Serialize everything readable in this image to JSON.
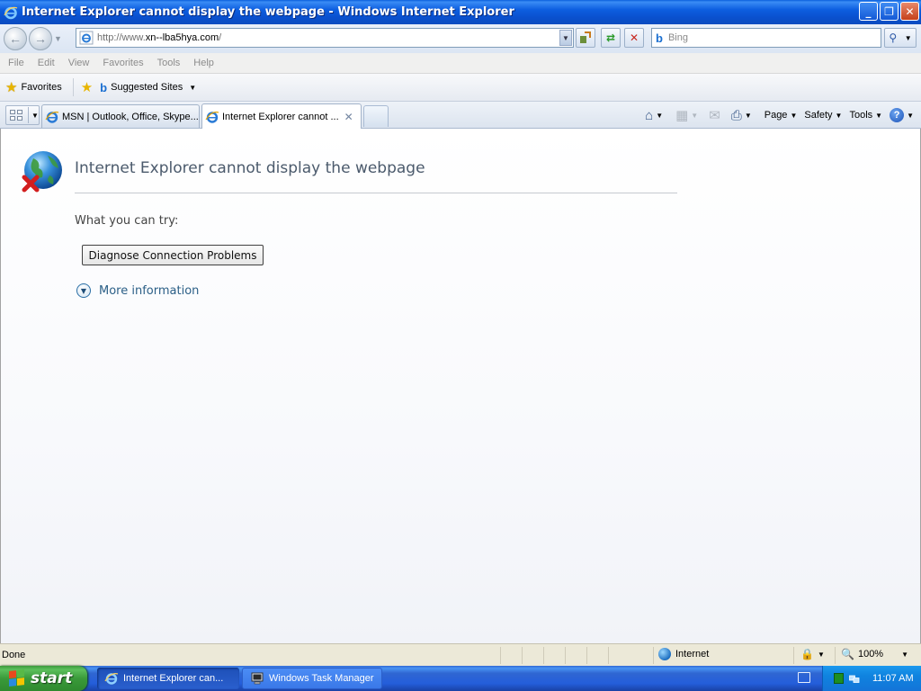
{
  "window": {
    "title": "Internet Explorer cannot display the webpage - Windows Internet Explorer",
    "minimize_glyph": "_",
    "restore_glyph": "❐",
    "close_glyph": "✕"
  },
  "address_bar": {
    "url_prefix": "http://www.",
    "url_host": "xn--lba5hya.com",
    "url_suffix": "/",
    "search_placeholder": "Bing"
  },
  "menu": {
    "items": [
      "File",
      "Edit",
      "View",
      "Favorites",
      "Tools",
      "Help"
    ]
  },
  "favorites_bar": {
    "favorites_label": "Favorites",
    "suggested_sites_label": "Suggested Sites"
  },
  "tabs": [
    {
      "label": "MSN | Outlook, Office, Skype...",
      "active": false
    },
    {
      "label": "Internet Explorer cannot ...",
      "active": true
    }
  ],
  "command_bar": {
    "page_label": "Page",
    "safety_label": "Safety",
    "tools_label": "Tools"
  },
  "error_page": {
    "title": "Internet Explorer cannot display the webpage",
    "try_label": "What you can try:",
    "diagnose_button": "Diagnose Connection Problems",
    "more_info_link": "More information"
  },
  "status_bar": {
    "status_text": "Done",
    "zone_label": "Internet",
    "zoom_label": "100%"
  },
  "taskbar": {
    "start_label": "start",
    "items": [
      {
        "label": "Internet Explorer can...",
        "active": true
      },
      {
        "label": "Windows Task Manager",
        "active": false
      }
    ],
    "clock": "11:07 AM"
  },
  "colors": {
    "title_bar": "#0a51cf",
    "link": "#2b5f87",
    "start_button": "#3a9a3a",
    "taskbar": "#245edb"
  }
}
